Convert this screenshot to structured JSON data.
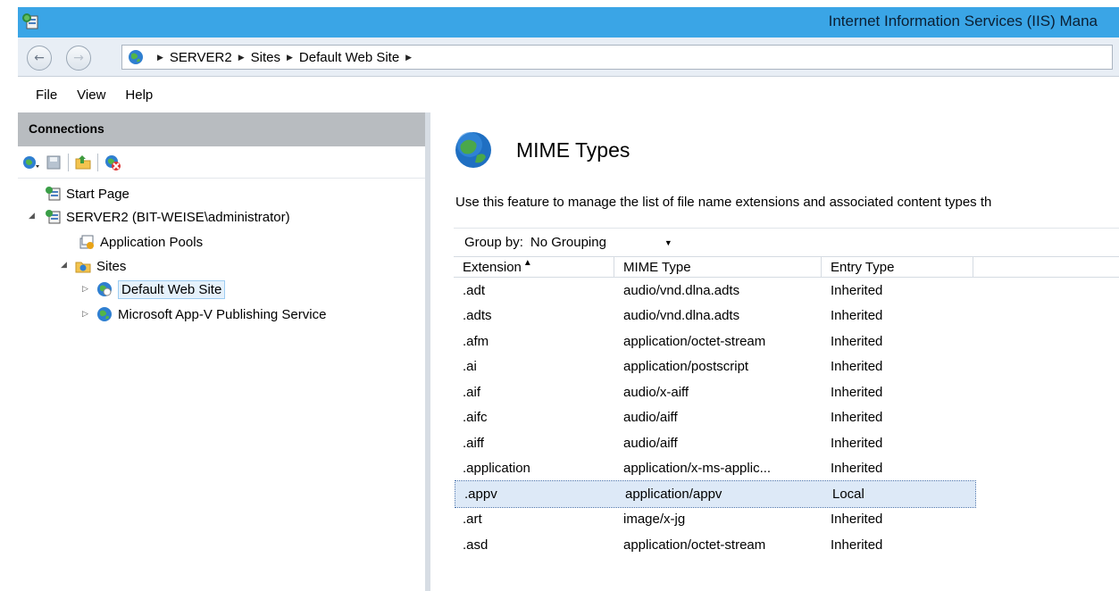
{
  "window": {
    "title": "Internet Information Services (IIS) Mana"
  },
  "address": {
    "crumbs": [
      "SERVER2",
      "Sites",
      "Default Web Site"
    ]
  },
  "menu": {
    "items": [
      "File",
      "View",
      "Help"
    ]
  },
  "connections": {
    "header": "Connections",
    "tree": {
      "start_page": "Start Page",
      "server": "SERVER2 (BIT-WEISE\\administrator)",
      "app_pools": "Application Pools",
      "sites": "Sites",
      "default_site": "Default Web Site",
      "appv_site": "Microsoft App-V Publishing Service"
    }
  },
  "feature": {
    "title": "MIME Types",
    "description": "Use this feature to manage the list of file name extensions and associated content types th",
    "group_by_label": "Group by:",
    "group_by_value": "No Grouping",
    "columns": {
      "extension": "Extension",
      "mime_type": "MIME Type",
      "entry_type": "Entry Type"
    },
    "rows": [
      {
        "ext": ".adt",
        "mime": "audio/vnd.dlna.adts",
        "entry": "Inherited"
      },
      {
        "ext": ".adts",
        "mime": "audio/vnd.dlna.adts",
        "entry": "Inherited"
      },
      {
        "ext": ".afm",
        "mime": "application/octet-stream",
        "entry": "Inherited"
      },
      {
        "ext": ".ai",
        "mime": "application/postscript",
        "entry": "Inherited"
      },
      {
        "ext": ".aif",
        "mime": "audio/x-aiff",
        "entry": "Inherited"
      },
      {
        "ext": ".aifc",
        "mime": "audio/aiff",
        "entry": "Inherited"
      },
      {
        "ext": ".aiff",
        "mime": "audio/aiff",
        "entry": "Inherited"
      },
      {
        "ext": ".application",
        "mime": "application/x-ms-applic...",
        "entry": "Inherited"
      },
      {
        "ext": ".appv",
        "mime": "application/appv",
        "entry": "Local"
      },
      {
        "ext": ".art",
        "mime": "image/x-jg",
        "entry": "Inherited"
      },
      {
        "ext": ".asd",
        "mime": "application/octet-stream",
        "entry": "Inherited"
      }
    ],
    "selected_row": 8
  },
  "colors": {
    "titlebar": "#3aa5e6",
    "selection": "#dde9f7",
    "connections_header": "#b8bcc0"
  }
}
